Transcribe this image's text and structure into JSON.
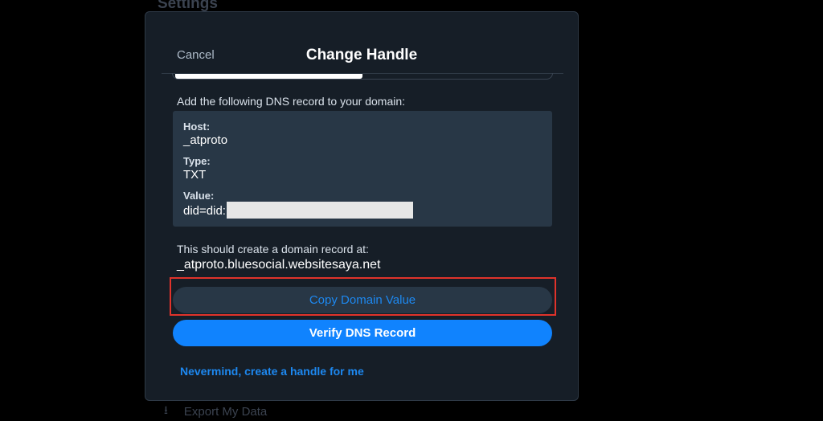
{
  "background": {
    "settings_title": "Settings",
    "export_label": "Export My Data",
    "export_icon": "download-icon"
  },
  "modal": {
    "cancel_label": "Cancel",
    "title": "Change Handle",
    "instruction": "Add the following DNS record to your domain:",
    "dns": {
      "host_label": "Host:",
      "host_value": "_atproto",
      "type_label": "Type:",
      "type_value": "TXT",
      "value_label": "Value:",
      "value_prefix": "did=did:"
    },
    "record_intro": "This should create a domain record at:",
    "record_value": "_atproto.bluesocial.websitesaya.net",
    "copy_button": "Copy Domain Value",
    "verify_button": "Verify DNS Record",
    "nevermind_link": "Nevermind, create a handle for me"
  },
  "colors": {
    "accent": "#1083fe",
    "link": "#1d88f0",
    "highlight_border": "#e0332b",
    "modal_bg": "#161e27",
    "box_bg": "#283746"
  }
}
